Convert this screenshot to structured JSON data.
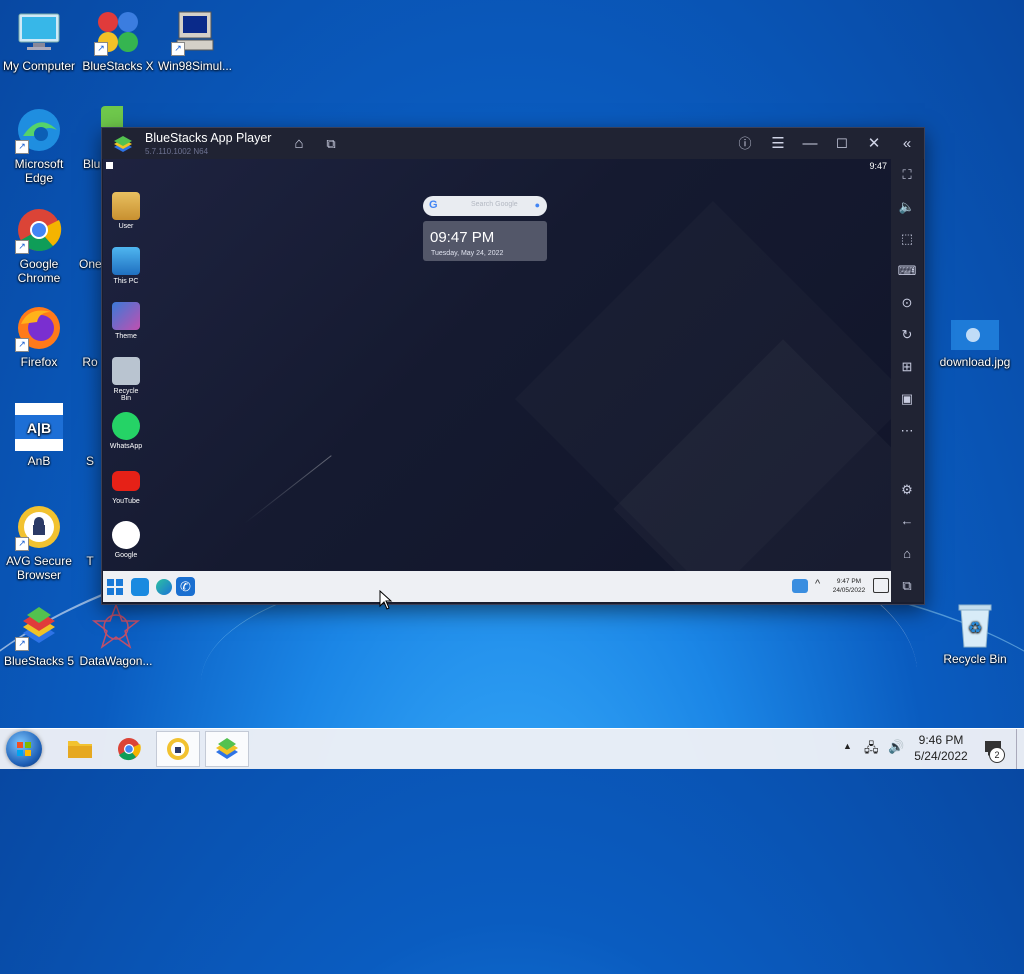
{
  "desktop": {
    "icons": [
      {
        "label": "My Computer"
      },
      {
        "label": "BlueStacks X"
      },
      {
        "label": "Win98Simul..."
      },
      {
        "label": "Microsoft Edge"
      },
      {
        "label": "Blu Mu"
      },
      {
        "label": "Google Chrome"
      },
      {
        "label": "One"
      },
      {
        "label": "Firefox"
      },
      {
        "label": "Ro"
      },
      {
        "label": "AnB"
      },
      {
        "label": "S"
      },
      {
        "label": "AVG Secure Browser"
      },
      {
        "label": "T"
      },
      {
        "label": "BlueStacks 5"
      },
      {
        "label": "DataWagon..."
      },
      {
        "label": "download.jpg"
      },
      {
        "label": "Recycle Bin"
      }
    ]
  },
  "bluestacks": {
    "title": "BlueStacks App Player",
    "version": "5.7.110.1002  N64",
    "android": {
      "status_time": "9:47",
      "apps": [
        {
          "label": "User"
        },
        {
          "label": "This PC"
        },
        {
          "label": "Theme"
        },
        {
          "label": "Recycle Bin"
        },
        {
          "label": "WhatsApp"
        },
        {
          "label": "YouTube"
        },
        {
          "label": "Google"
        }
      ],
      "search_placeholder": "Search Google",
      "clock_time": "09:47 PM",
      "clock_date": "Tuesday, May 24, 2022",
      "taskbar_time": "9:47 PM",
      "taskbar_date": "24/05/2022"
    }
  },
  "taskbar": {
    "clock_time": "9:46 PM",
    "clock_date": "5/24/2022",
    "notification_count": "2"
  }
}
